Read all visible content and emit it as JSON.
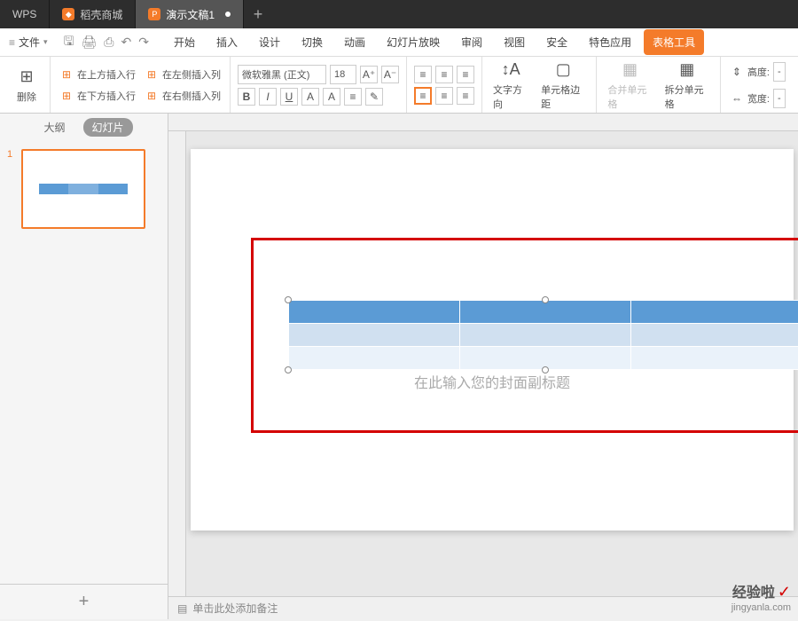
{
  "titlebar": {
    "wps": "WPS",
    "tab1": "稻壳商城",
    "tab2": "演示文稿1"
  },
  "menubar": {
    "file": "文件",
    "menus": [
      "开始",
      "插入",
      "设计",
      "切换",
      "动画",
      "幻灯片放映",
      "审阅",
      "视图",
      "安全",
      "特色应用",
      "表格工具"
    ]
  },
  "ribbon": {
    "delete": "删除",
    "insert_above": "在上方插入行",
    "insert_below": "在下方插入行",
    "insert_left": "在左侧插入列",
    "insert_right": "在右侧插入列",
    "font_name": "微软雅黑 (正文)",
    "font_size": "18",
    "text_dir": "文字方向",
    "cell_margin": "单元格边距",
    "merge": "合并单元格",
    "split": "拆分单元格",
    "height": "高度:",
    "width": "宽度:"
  },
  "sidebar": {
    "tab_outline": "大纲",
    "tab_slides": "幻灯片",
    "slide_num": "1"
  },
  "slide": {
    "placeholder": "在此输入您的封面副标题"
  },
  "notes": {
    "text": "单击此处添加备注"
  },
  "watermark": {
    "brand": "经验啦",
    "url": "jingyanla.com"
  }
}
